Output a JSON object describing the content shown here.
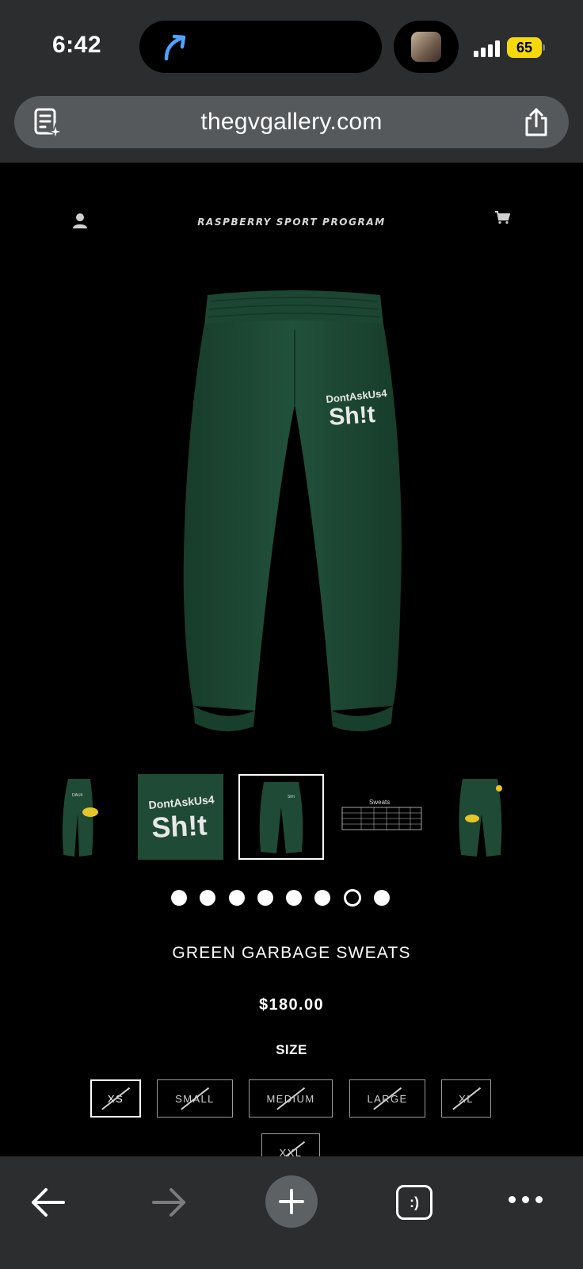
{
  "status_bar": {
    "time": "6:42",
    "battery": "65"
  },
  "browser": {
    "url": "thegvgallery.com",
    "tabs_label": ":)"
  },
  "site": {
    "brand": "RASPBERRY SPORT PROGRAM"
  },
  "product": {
    "title": "GREEN GARBAGE SWEATS",
    "price": "$180.00",
    "size_label": "SIZE",
    "sizes": [
      {
        "label": "XS",
        "selected": true,
        "sold_out": true
      },
      {
        "label": "SMALL",
        "selected": false,
        "sold_out": true
      },
      {
        "label": "MEDIUM",
        "selected": false,
        "sold_out": true
      },
      {
        "label": "LARGE",
        "selected": false,
        "sold_out": true
      },
      {
        "label": "XL",
        "selected": false,
        "sold_out": true
      },
      {
        "label": "XXL",
        "selected": false,
        "sold_out": true
      }
    ],
    "gallery": {
      "image_count": 8,
      "active_index": 6,
      "active_thumbnail": 3
    },
    "print_text": {
      "line1": "DontAskUs4",
      "line2": "Sh!t"
    },
    "size_chart_title": "Sweats",
    "colors": {
      "fabric": "#1f4a35",
      "fabric_dark": "#163a29",
      "accent_yellow": "#e6c52b"
    }
  }
}
